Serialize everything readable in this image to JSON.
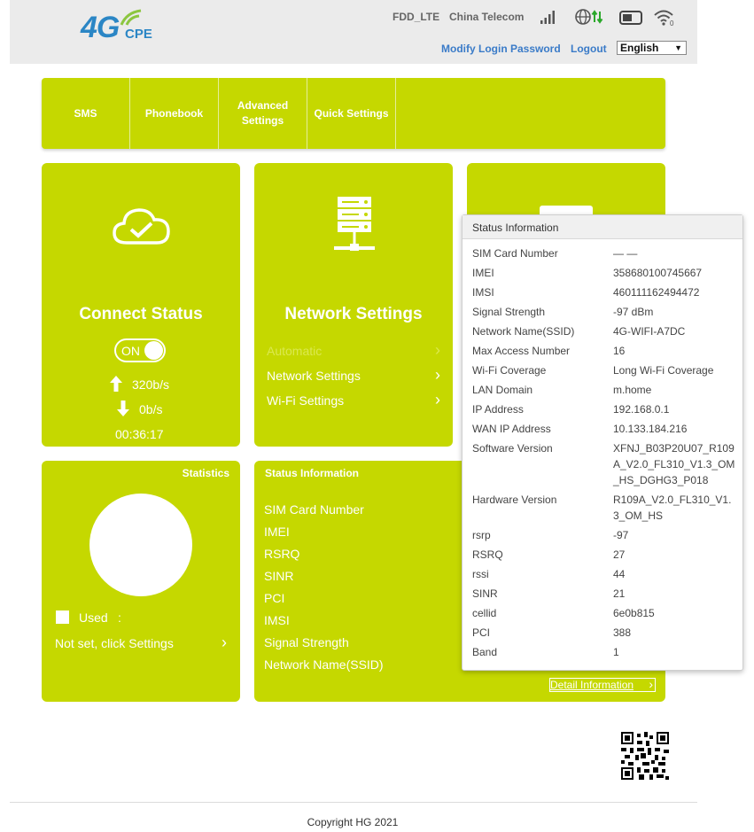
{
  "header": {
    "network_type": "FDD_LTE",
    "operator": "China Telecom",
    "modify_password": "Modify Login Password",
    "logout": "Logout",
    "language": "English"
  },
  "logo": {
    "main": "4G",
    "sub": "CPE"
  },
  "nav": {
    "items": [
      {
        "label": "SMS"
      },
      {
        "label": "Phonebook"
      },
      {
        "label": "Advanced Settings"
      },
      {
        "label": "Quick Settings"
      }
    ]
  },
  "connect_card": {
    "title": "Connect Status",
    "toggle": "ON",
    "upload": "320b/s",
    "download": "0b/s",
    "duration": "00:36:17"
  },
  "network_card": {
    "title": "Network Settings",
    "items": [
      {
        "label": "Automatic"
      },
      {
        "label": "Network Settings"
      },
      {
        "label": "Wi-Fi Settings"
      }
    ]
  },
  "statistics_card": {
    "title": "Statistics",
    "used_label": "Used",
    "used_value": ":",
    "settings_link": "Not set, click Settings"
  },
  "status_card": {
    "title": "Status Information",
    "labels": [
      "SIM Card Number",
      "IMEI",
      "RSRQ",
      "SINR",
      "PCI",
      "IMSI",
      "Signal Strength",
      "Network Name(SSID)"
    ],
    "detail_link": "Detail Information"
  },
  "popup": {
    "title": "Status Information",
    "rows": [
      {
        "key": "SIM Card Number",
        "value": "— —"
      },
      {
        "key": "IMEI",
        "value": "358680100745667"
      },
      {
        "key": "IMSI",
        "value": "460111162494472"
      },
      {
        "key": "Signal Strength",
        "value": "-97 dBm"
      },
      {
        "key": "Network Name(SSID)",
        "value": "4G-WIFI-A7DC"
      },
      {
        "key": "Max Access Number",
        "value": "16"
      },
      {
        "key": "Wi-Fi Coverage",
        "value": "Long Wi-Fi Coverage"
      },
      {
        "key": "LAN Domain",
        "value": "m.home"
      },
      {
        "key": "IP Address",
        "value": "192.168.0.1"
      },
      {
        "key": "WAN IP Address",
        "value": "10.133.184.216"
      },
      {
        "key": "Software Version",
        "value": "XFNJ_B03P20U07_R109A_V2.0_FL310_V1.3_OM_HS_DGHG3_P018"
      },
      {
        "key": "Hardware Version",
        "value": "R109A_V2.0_FL310_V1.3_OM_HS"
      },
      {
        "key": "rsrp",
        "value": "-97"
      },
      {
        "key": "RSRQ",
        "value": "27"
      },
      {
        "key": "rssi",
        "value": "44"
      },
      {
        "key": "SINR",
        "value": "21"
      },
      {
        "key": "cellid",
        "value": "6e0b815"
      },
      {
        "key": "PCI",
        "value": "388"
      },
      {
        "key": "Band",
        "value": "1"
      }
    ]
  },
  "footer": {
    "copyright": "Copyright HG 2021"
  },
  "colors": {
    "accent": "#c5d800",
    "link": "#3a7bc8",
    "logo": "#2b86c5"
  }
}
